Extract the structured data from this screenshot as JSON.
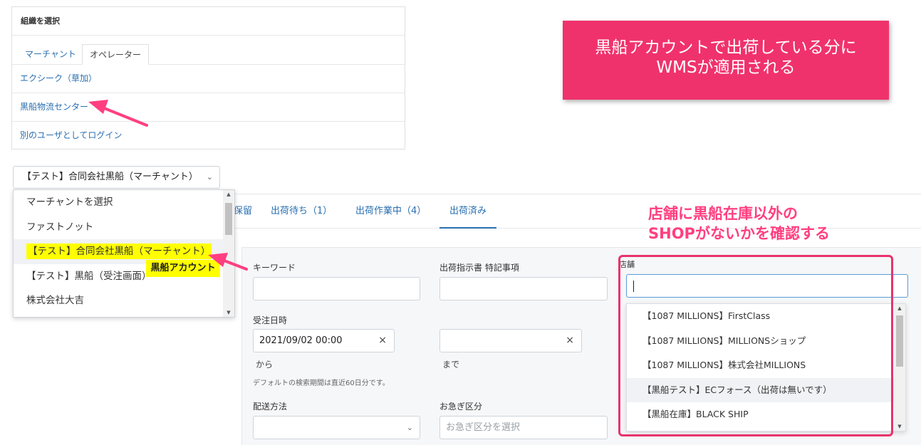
{
  "org_panel": {
    "title": "組織を選択",
    "tabs": [
      "マーチャント",
      "オペレーター"
    ],
    "items": [
      "エクシーク（草加）",
      "黒船物流センター",
      "別のユーザとしてログイン"
    ]
  },
  "merchant_select": {
    "value": "【テスト】合同会社黒船（マーチャント）",
    "options": [
      "マーチャントを選択",
      "ファストノット",
      "【テスト】合同会社黒船（マーチャント）",
      "【テスト】黒船（受注画面）",
      "株式会社大吉"
    ]
  },
  "annotations": {
    "kurofune_account": "黒船アカウント",
    "callout_line1": "黒船アカウントで出荷している分に",
    "callout_line2": "WMSが適用される",
    "check_line1": "店舗に黒船在庫以外の",
    "check_line2": "SHOPがないかを確認する"
  },
  "tabs": [
    "保留",
    "出荷待ち（1）",
    "出荷作業中（4）",
    "出荷済み"
  ],
  "filters": {
    "keyword_label": "キーワード",
    "shipping_note_label": "出荷指示書 特記事項",
    "store_label": "店舗",
    "order_date_label": "受注日時",
    "date_from_value": "2021/09/02 00:00",
    "from_label": "から",
    "to_label": "まで",
    "default_note": "デフォルトの検索期間は直近60日分です。",
    "delivery_label": "配送方法",
    "urgency_label": "お急ぎ区分",
    "urgency_placeholder": "お急ぎ区分を選択"
  },
  "store_options": [
    "【1087 MILLIONS】FirstClass",
    "【1087 MILLIONS】MILLIONSショップ",
    "【1087 MILLIONS】株式会社MILLIONS",
    "【黒船テスト】ECフォース（出荷は無いです）",
    "【黒船在庫】BLACK SHIP"
  ],
  "icons": {
    "clear": "×",
    "chevron": "⌄",
    "up": "▲",
    "down": "▼"
  },
  "colors": {
    "accent": "#2a6fb0",
    "callout": "#f0326c",
    "highlight": "#ffff00",
    "annotation_pink": "#ff3f80"
  }
}
